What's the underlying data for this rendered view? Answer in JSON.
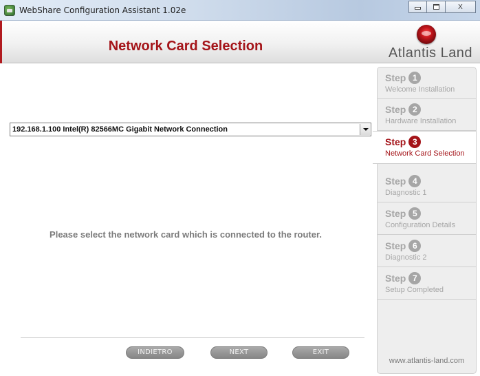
{
  "window": {
    "title": "WebShare Configuration Assistant 1.02e",
    "icon": "app-icon",
    "controls": [
      "minimize-icon",
      "maximize-icon",
      "close-icon"
    ],
    "close_glyph": "X"
  },
  "header": {
    "title": "Network Card Selection",
    "brand": "Atlantis Land",
    "title_color": "#a41419"
  },
  "main": {
    "network_card": "192.168.1.100 Intel(R) 82566MC Gigabit Network Connection",
    "instruction": "Please select the network card which is connected to the router."
  },
  "buttons": {
    "back": "INDIETRO",
    "next": "NEXT",
    "exit": "EXIT"
  },
  "sidebar": {
    "step_word": "Step",
    "active_step": 3,
    "active_color": "#a41419",
    "steps": [
      {
        "num": "1",
        "label": "Welcome Installation"
      },
      {
        "num": "2",
        "label": "Hardware Installation"
      },
      {
        "num": "3",
        "label": "Network Card Selection"
      },
      {
        "num": "4",
        "label": "Diagnostic 1"
      },
      {
        "num": "5",
        "label": "Configuration Details"
      },
      {
        "num": "6",
        "label": "Diagnostic 2"
      },
      {
        "num": "7",
        "label": "Setup Completed"
      }
    ],
    "website": "www.atlantis-land.com"
  }
}
